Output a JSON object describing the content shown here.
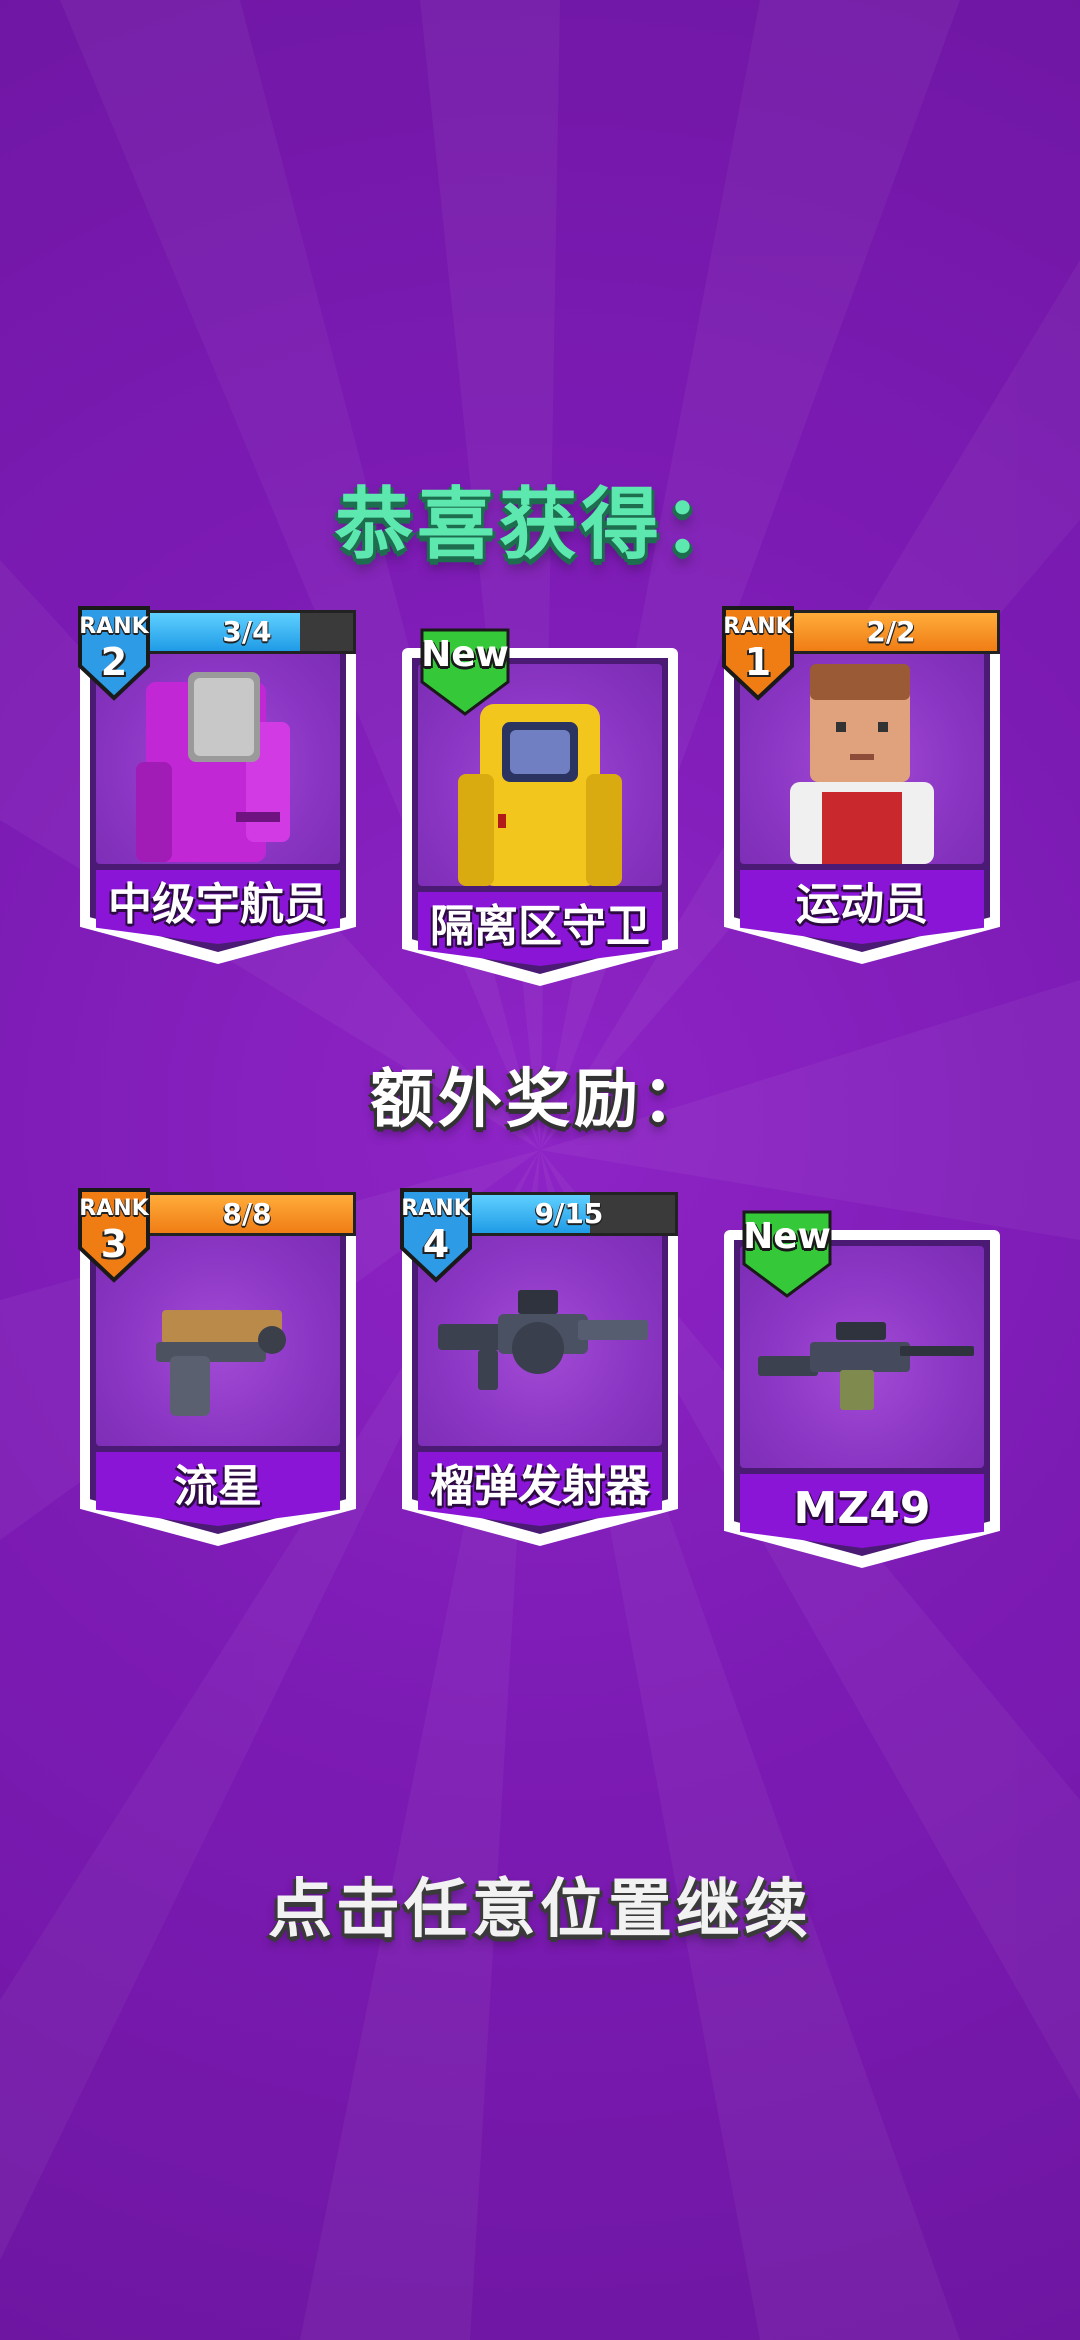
{
  "header": {
    "title": "恭喜获得："
  },
  "characters_section": {
    "cards": [
      {
        "name": "中级宇航员",
        "rank_label": "RANK",
        "rank": "2",
        "progress_text": "3/4",
        "progress_fraction": 0.75,
        "bar_color": "blue",
        "badge_color": "#2d9be6",
        "is_new": false,
        "art_icon": "pink-astronaut-icon"
      },
      {
        "name": "隔离区守卫",
        "new_label": "New",
        "is_new": true,
        "art_icon": "yellow-hazmat-suit-icon"
      },
      {
        "name": "运动员",
        "rank_label": "RANK",
        "rank": "1",
        "progress_text": "2/2",
        "progress_fraction": 1.0,
        "bar_color": "orange",
        "badge_color": "#f07d14",
        "is_new": false,
        "art_icon": "athlete-character-icon"
      }
    ]
  },
  "bonus_section": {
    "title": "额外奖励：",
    "cards": [
      {
        "name": "流星",
        "rank_label": "RANK",
        "rank": "3",
        "progress_text": "8/8",
        "progress_fraction": 1.0,
        "bar_color": "orange",
        "badge_color": "#f07d14",
        "is_new": false,
        "art_icon": "pistol-icon"
      },
      {
        "name": "榴弹发射器",
        "rank_label": "RANK",
        "rank": "4",
        "progress_text": "9/15",
        "progress_fraction": 0.6,
        "bar_color": "blue",
        "badge_color": "#2d9be6",
        "is_new": false,
        "art_icon": "grenade-launcher-icon"
      },
      {
        "name": "MZ49",
        "new_label": "New",
        "is_new": true,
        "art_icon": "machine-gun-icon"
      }
    ]
  },
  "footer": {
    "continue_text": "点击任意位置继续"
  },
  "colors": {
    "background": "#7d1bb5",
    "title_green": "#5de8b0",
    "name_bar": "#8a15d6",
    "new_green": "#35c93a"
  }
}
